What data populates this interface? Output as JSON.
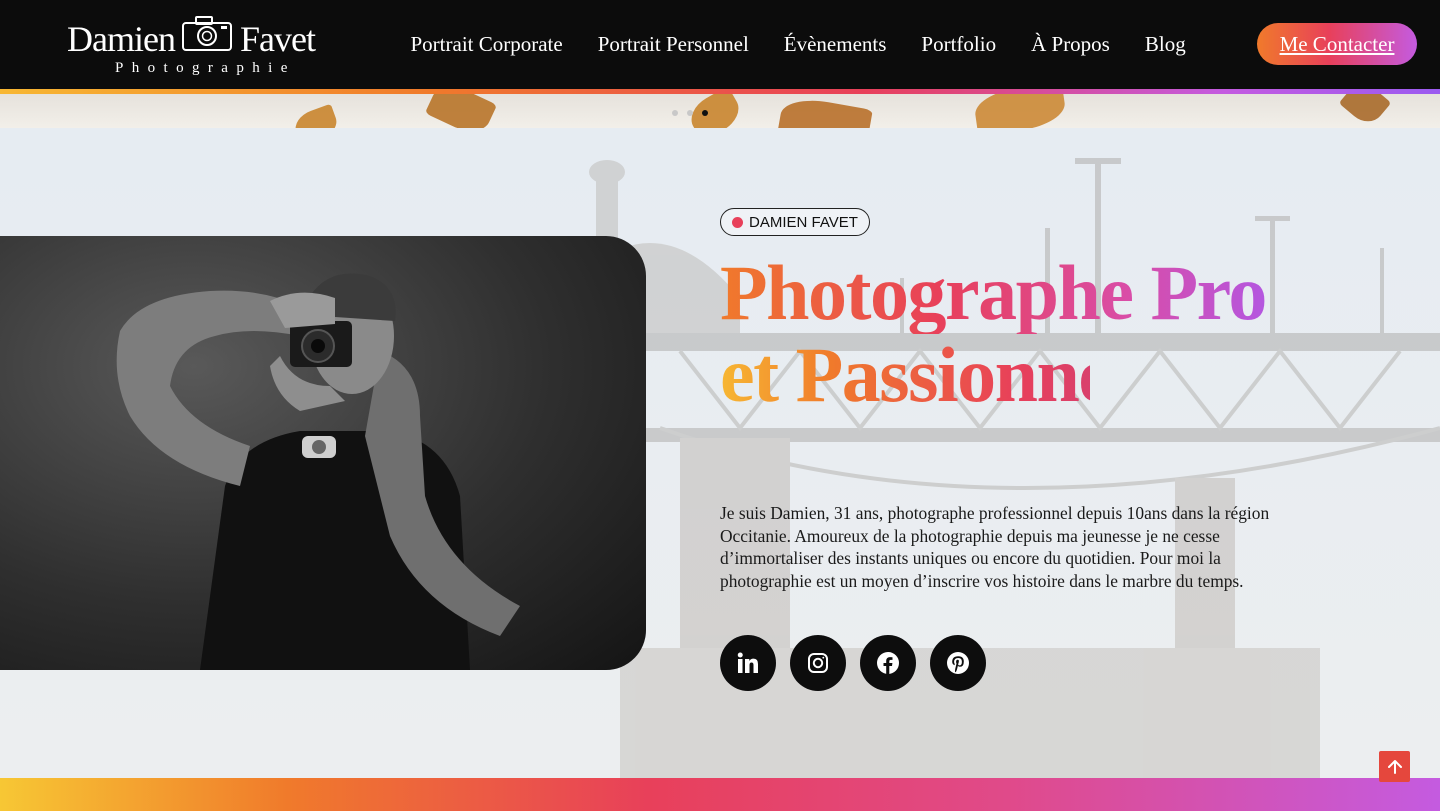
{
  "header": {
    "logo": {
      "first": "Damien",
      "last": "Favet",
      "sub": "Photographie"
    },
    "nav": [
      {
        "label": "Portrait Corporate"
      },
      {
        "label": "Portrait Personnel"
      },
      {
        "label": "Évènements"
      },
      {
        "label": "Portfolio"
      },
      {
        "label": "À Propos"
      },
      {
        "label": "Blog"
      }
    ],
    "cta_label": "Me Contacter"
  },
  "slider": {
    "dots": 3,
    "active_dot": 2
  },
  "hero": {
    "badge": "DAMIEN FAVET",
    "headline_line1": "Photographe Pro",
    "headline_line2": "et Passionné",
    "bio": "Je suis Damien, 31 ans, photographe professionnel depuis 10ans dans la région Occitanie. Amoureux de la photographie depuis ma jeunesse je ne cesse d’immortaliser des instants uniques ou encore du quotidien. Pour moi la photographie est un moyen d’inscrire vos histoire dans le marbre du temps.",
    "socials": [
      {
        "icon": "linkedin-icon"
      },
      {
        "icon": "instagram-icon"
      },
      {
        "icon": "facebook-icon"
      },
      {
        "icon": "pinterest-icon"
      }
    ]
  },
  "colors": {
    "accent_orange": "#f07a2b",
    "accent_red": "#e8405a",
    "accent_purple": "#c45be0",
    "header_bg": "#0c0c0c"
  }
}
